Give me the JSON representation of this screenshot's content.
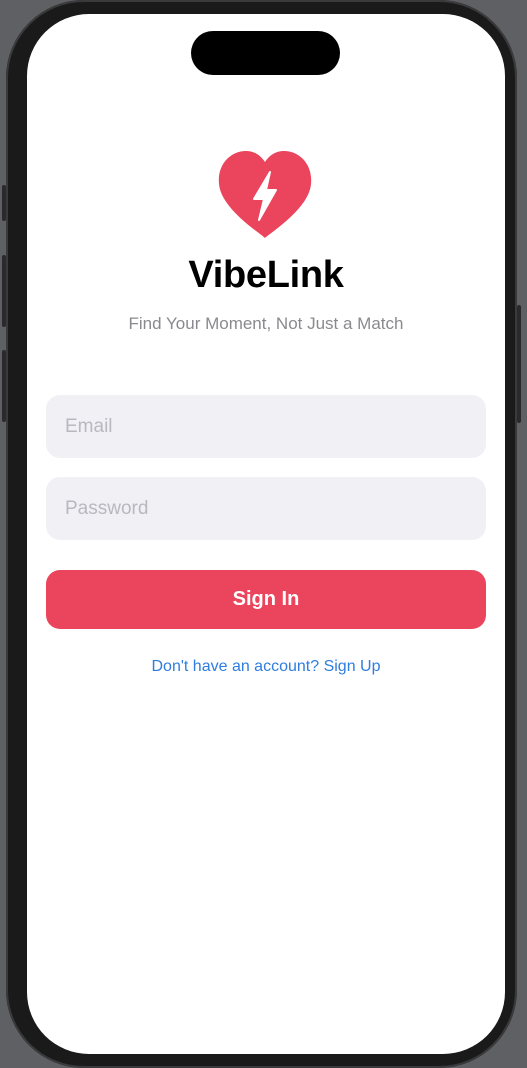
{
  "app": {
    "title": "VibeLink",
    "tagline": "Find Your Moment, Not Just a Match",
    "logo_icon": "heart-bolt-icon",
    "accent_color": "#ea455c"
  },
  "form": {
    "email_placeholder": "Email",
    "email_value": "",
    "password_placeholder": "Password",
    "password_value": "",
    "sign_in_label": "Sign In",
    "sign_up_link": "Don't have an account? Sign Up",
    "link_color": "#2f7ddf"
  }
}
